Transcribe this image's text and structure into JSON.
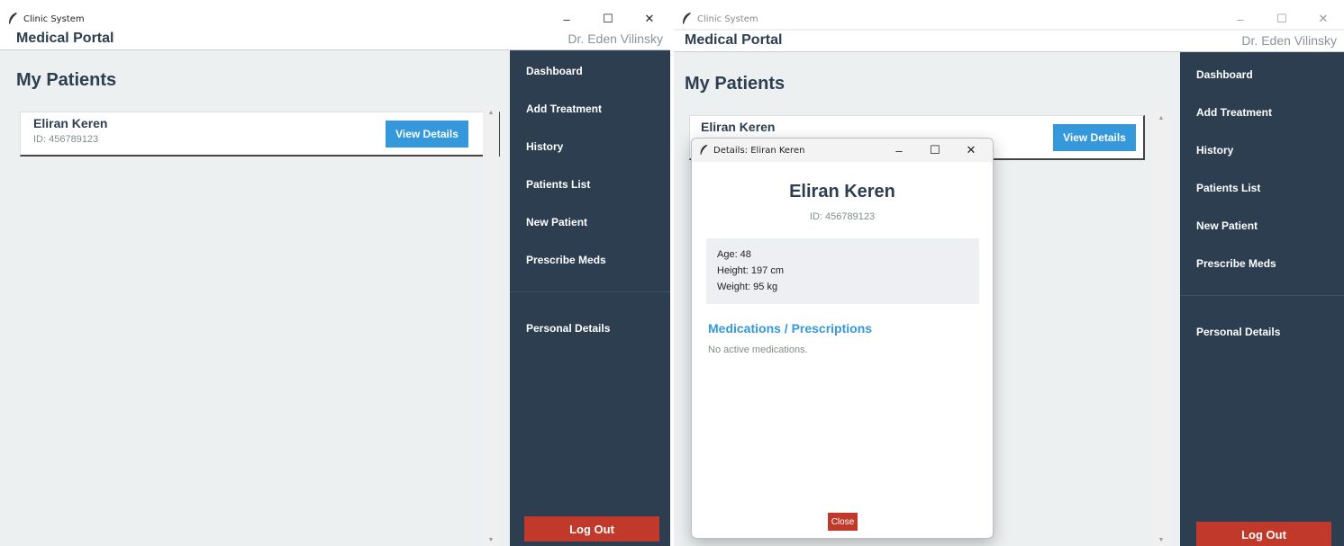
{
  "window": {
    "title": "Clinic System",
    "min": "–",
    "max": "☐",
    "close": "✕"
  },
  "header": {
    "portal": "Medical Portal",
    "user": "Dr. Eden Vilinsky"
  },
  "main": {
    "title": "My Patients",
    "patients": [
      {
        "name": "Eliran Keren",
        "id": "ID: 456789123",
        "button": "View Details"
      }
    ]
  },
  "sidebar": {
    "items": [
      {
        "label": "Dashboard"
      },
      {
        "label": "Add Treatment"
      },
      {
        "label": "History"
      },
      {
        "label": "Patients List"
      },
      {
        "label": "New Patient"
      },
      {
        "label": "Prescribe Meds"
      }
    ],
    "personal": "Personal Details",
    "logout": "Log Out"
  },
  "dialog": {
    "title": "Details: Eliran Keren",
    "name": "Eliran Keren",
    "id": "ID: 456789123",
    "age": "Age: 48",
    "height": "Height: 197 cm",
    "weight": "Weight: 95 kg",
    "med_heading": "Medications / Prescriptions",
    "med_empty": "No active medications.",
    "close": "Close"
  },
  "icons": {
    "app": "feather-icon"
  },
  "colors": {
    "sidebar": "#2c3e50",
    "accent": "#3498db",
    "danger": "#c0392b",
    "background": "#ecf0f1"
  }
}
